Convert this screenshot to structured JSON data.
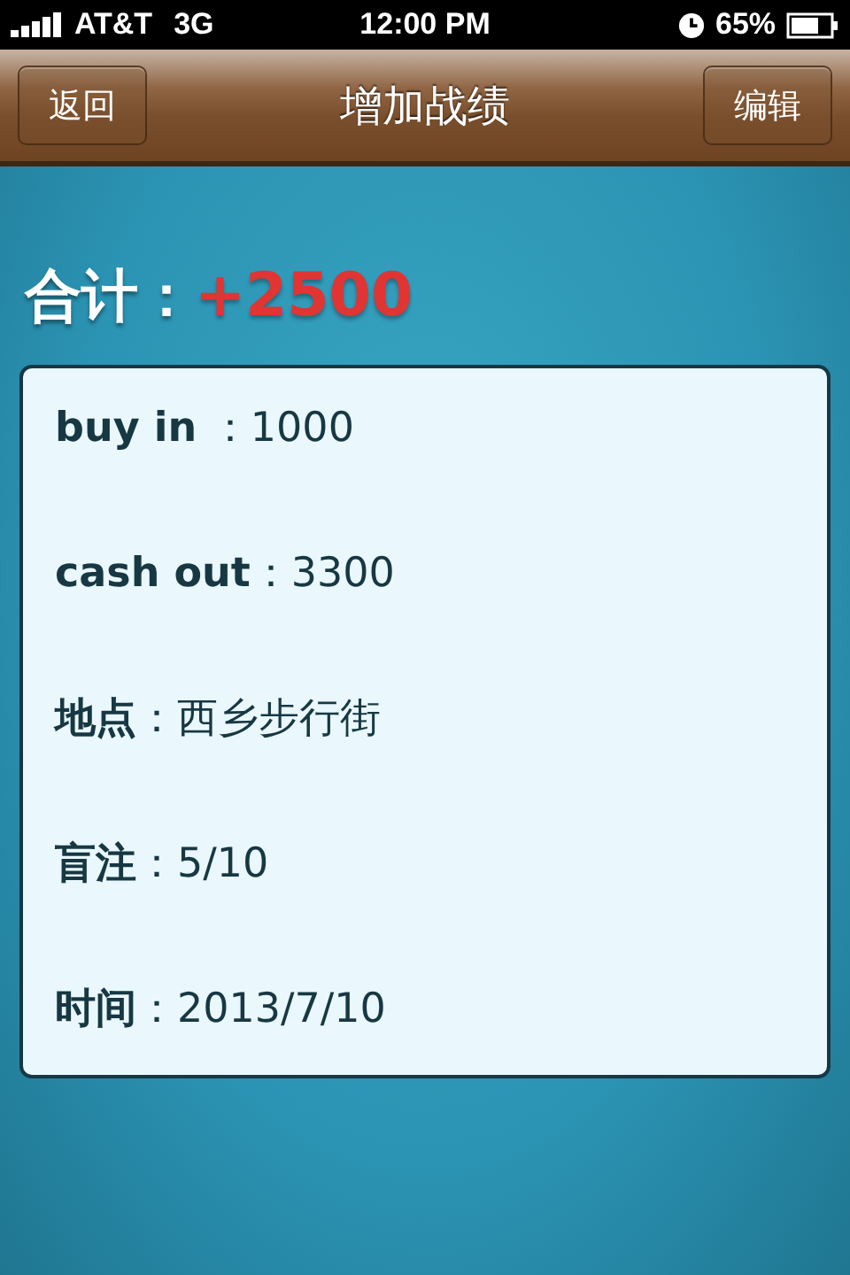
{
  "status_bar": {
    "carrier": "AT&T",
    "network": "3G",
    "time": "12:00 PM",
    "battery": "65%"
  },
  "nav_bar": {
    "back": "返回",
    "title": "增加战绩",
    "edit": "编辑"
  },
  "total": {
    "label": "合计：",
    "value": "+2500"
  },
  "details": [
    {
      "text": "**buy in** ：1000"
    },
    {
      "text": "**cash out**：3300"
    },
    {
      "text": "**地点**：西乡步行街"
    },
    {
      "text": "**盲注**：5/10"
    },
    {
      "text": "**时间**：2013/7/10"
    }
  ]
}
